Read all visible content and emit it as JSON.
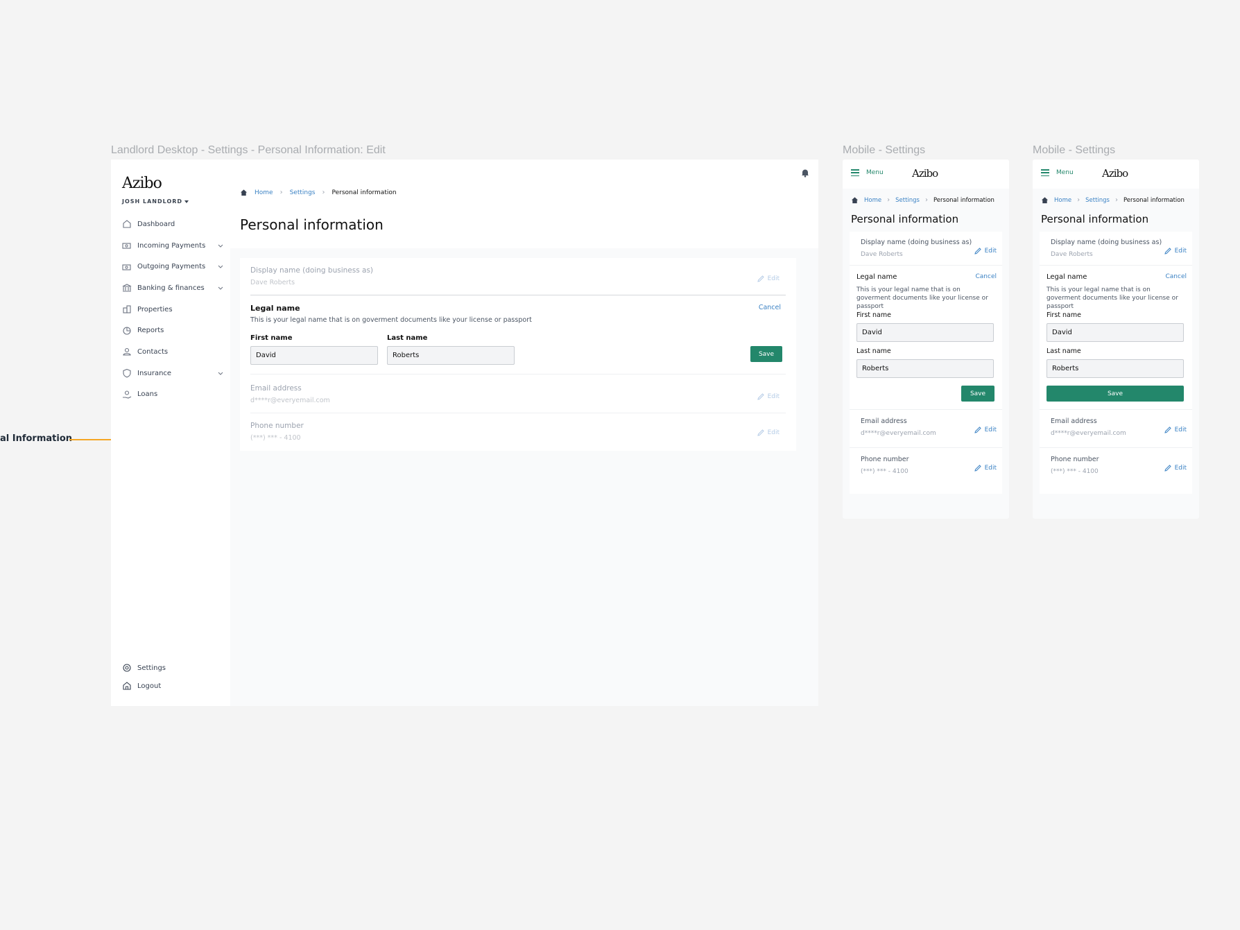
{
  "frames": {
    "desktop_label": "Landlord Desktop - Settings - Personal Information: Edit",
    "mobile1_label": "Mobile - Settings",
    "mobile2_label": "Mobile - Settings"
  },
  "annotation": {
    "text": "al Information",
    "arrow_color": "#f5a623"
  },
  "app": {
    "logo": "Azibo",
    "user": "JOSH LANDLORD",
    "nav": [
      {
        "label": "Dashboard",
        "icon": "home-outline-icon",
        "expandable": false
      },
      {
        "label": "Incoming Payments",
        "icon": "cash-icon",
        "expandable": true
      },
      {
        "label": "Outgoing Payments",
        "icon": "cash-icon",
        "expandable": true
      },
      {
        "label": "Banking & finances",
        "icon": "bank-icon",
        "expandable": true
      },
      {
        "label": "Properties",
        "icon": "building-icon",
        "expandable": false
      },
      {
        "label": "Reports",
        "icon": "chart-pie-icon",
        "expandable": false
      },
      {
        "label": "Contacts",
        "icon": "user-icon",
        "expandable": false
      },
      {
        "label": "Insurance",
        "icon": "shield-icon",
        "expandable": true
      },
      {
        "label": "Loans",
        "icon": "loan-icon",
        "expandable": false
      }
    ],
    "nav_bottom": [
      {
        "label": "Settings",
        "icon": "gear-icon"
      },
      {
        "label": "Logout",
        "icon": "logout-icon"
      }
    ]
  },
  "breadcrumb": {
    "home": "Home",
    "settings": "Settings",
    "current": "Personal information"
  },
  "page_title": "Personal information",
  "display_name": {
    "label": "Display name (doing business as)",
    "value": "Dave Roberts",
    "edit": "Edit"
  },
  "legal_name": {
    "label": "Legal name",
    "cancel": "Cancel",
    "description": "This is your legal name that is on goverment documents like your license or passport",
    "first_label": "First name",
    "first_value": "David",
    "last_label": "Last name",
    "last_value": "Roberts",
    "save": "Save"
  },
  "email": {
    "label": "Email address",
    "value": "d****r@everyemail.com",
    "edit": "Edit"
  },
  "phone": {
    "label": "Phone number",
    "value": "(***) *** - 4100",
    "edit": "Edit"
  },
  "mobile": {
    "menu": "Menu"
  },
  "colors": {
    "brand_green": "#23876b",
    "link_blue": "#3b82c4"
  }
}
